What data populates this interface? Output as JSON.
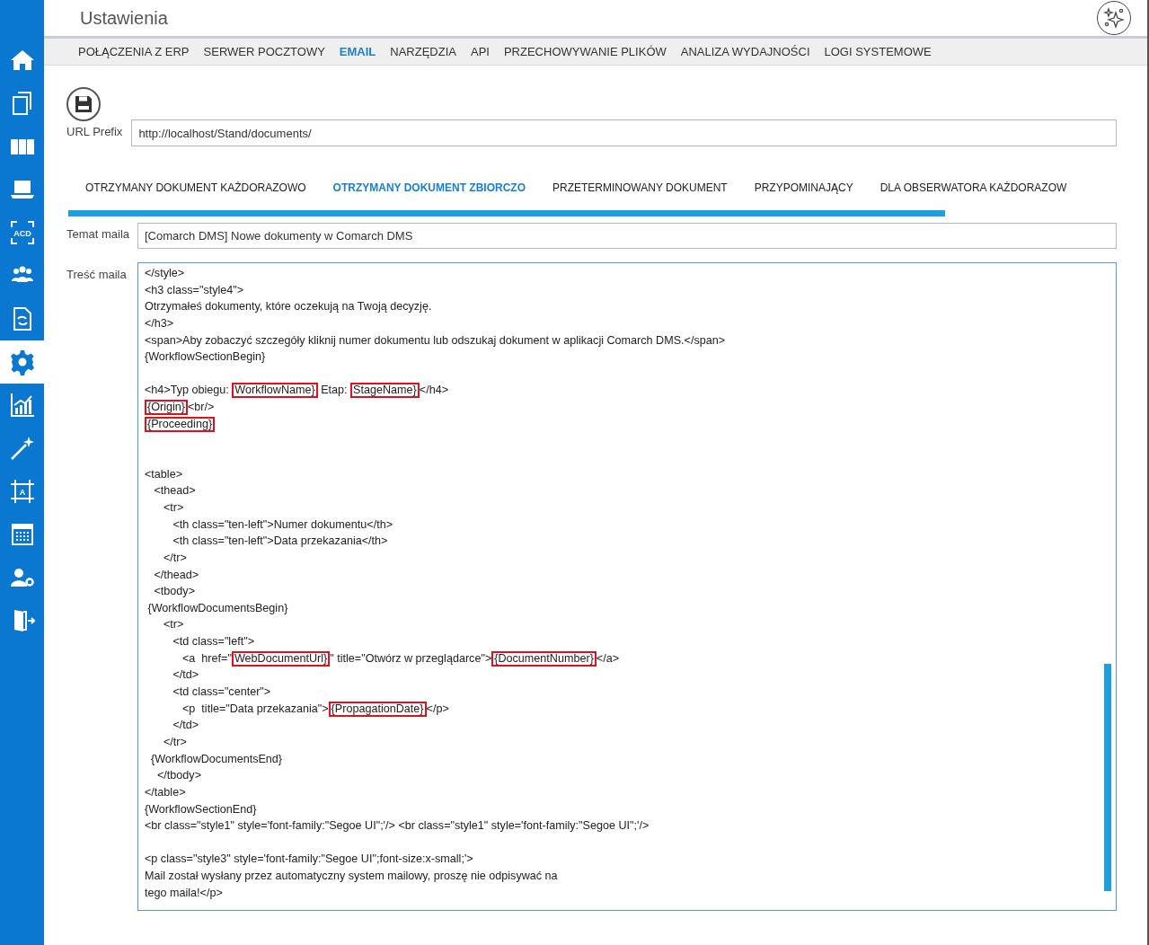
{
  "window": {
    "title": "Ustawienia"
  },
  "sidebar": {
    "items": [
      {
        "kind": "home",
        "selected": false
      },
      {
        "kind": "documents",
        "selected": false
      },
      {
        "kind": "binders",
        "selected": false
      },
      {
        "kind": "laptop",
        "selected": false
      },
      {
        "kind": "scan",
        "label": "ACD",
        "selected": false
      },
      {
        "kind": "people",
        "selected": false
      },
      {
        "kind": "doc-sync",
        "selected": false
      },
      {
        "kind": "gear",
        "selected": true
      },
      {
        "kind": "chart",
        "selected": false
      },
      {
        "kind": "wand",
        "selected": false
      },
      {
        "kind": "crop",
        "label": "A",
        "selected": false
      },
      {
        "kind": "calendar",
        "selected": false
      },
      {
        "kind": "user-gear",
        "selected": false
      },
      {
        "kind": "exit",
        "selected": false
      }
    ]
  },
  "nav": [
    {
      "label": "POŁĄCZENIA Z ERP",
      "selected": false
    },
    {
      "label": "SERWER POCZTOWY",
      "selected": false
    },
    {
      "label": "EMAIL",
      "selected": true
    },
    {
      "label": "NARZĘDZIA",
      "selected": false
    },
    {
      "label": "API",
      "selected": false
    },
    {
      "label": "PRZECHOWYWANIE PLIKÓW",
      "selected": false
    },
    {
      "label": "ANALIZA WYDAJNOŚCI",
      "selected": false
    },
    {
      "label": "LOGI SYSTEMOWE",
      "selected": false
    }
  ],
  "url_prefix": {
    "label": "URL Prefix",
    "value": "http://localhost/Stand/documents/"
  },
  "email_tabs": [
    {
      "label": "OTRZYMANY DOKUMENT KAŻDORAZOWO",
      "selected": false
    },
    {
      "label": "OTRZYMANY DOKUMENT ZBIORCZO",
      "selected": true
    },
    {
      "label": "PRZETERMINOWANY DOKUMENT",
      "selected": false
    },
    {
      "label": "PRZYPOMINAJĄCY",
      "selected": false
    },
    {
      "label": "DLA OBSERWATORA KAŻDORAZOW",
      "selected": false
    }
  ],
  "subject": {
    "label": "Temat maila",
    "value": "[Comarch DMS] Nowe dokumenty w Comarch DMS"
  },
  "body": {
    "label": "Treść maila",
    "lines": [
      {
        "kind": "code",
        "text": "</style>"
      },
      {
        "kind": "code",
        "text": "<h3 class=\"style4\">"
      },
      {
        "kind": "code",
        "text": "Otrzymałeś dokumenty, które oczekują na Twoją decyzję."
      },
      {
        "kind": "code",
        "text": "</h3>"
      },
      {
        "kind": "code",
        "text": "<span>Aby zobaczyć szczegóły kliknij numer dokumentu lub odszukaj dokument w aplikacji Comarch DMS.</span>"
      },
      {
        "kind": "code",
        "text": "{WorkflowSectionBegin}"
      },
      {
        "kind": "blank"
      },
      {
        "kind": "marked",
        "parts": [
          {
            "text": "<h4>Typ obiegu: ",
            "highlighted": false
          },
          {
            "text": "WorkflowName}",
            "highlighted": true
          },
          {
            "text": " Etap: ",
            "highlighted": false
          },
          {
            "text": "StageName}",
            "highlighted": true
          },
          {
            "text": "</h4>",
            "highlighted": false
          }
        ]
      },
      {
        "kind": "marked",
        "parts": [
          {
            "text": "{Origin}",
            "highlighted": true
          },
          {
            "text": "<br/>",
            "highlighted": false
          }
        ]
      },
      {
        "kind": "marked",
        "parts": [
          {
            "text": "{Proceeding}",
            "highlighted": true
          }
        ]
      },
      {
        "kind": "blank"
      },
      {
        "kind": "blank"
      },
      {
        "kind": "code",
        "text": "<table>"
      },
      {
        "kind": "code",
        "text": "   <thead>"
      },
      {
        "kind": "code",
        "text": "      <tr>"
      },
      {
        "kind": "code",
        "text": "         <th class=\"ten-left\">Numer dokumentu</th>"
      },
      {
        "kind": "code",
        "text": "         <th class=\"ten-left\">Data przekazania</th>"
      },
      {
        "kind": "code",
        "text": "      </tr>"
      },
      {
        "kind": "code",
        "text": "   </thead>"
      },
      {
        "kind": "code",
        "text": "   <tbody>"
      },
      {
        "kind": "code",
        "text": " {WorkflowDocumentsBegin}"
      },
      {
        "kind": "code",
        "text": "      <tr>"
      },
      {
        "kind": "code",
        "text": "         <td class=\"left\">"
      },
      {
        "kind": "marked",
        "parts": [
          {
            "text": "            <a  href=\"",
            "highlighted": false
          },
          {
            "text": "WebDocumentUrl}",
            "highlighted": true
          },
          {
            "text": "\" title=\"Otwórz w przeglądarce\">",
            "highlighted": false
          },
          {
            "text": "{DocumentNumber}",
            "highlighted": true
          },
          {
            "text": "</a>",
            "highlighted": false
          }
        ]
      },
      {
        "kind": "code",
        "text": "         </td>"
      },
      {
        "kind": "code",
        "text": "         <td class=\"center\">"
      },
      {
        "kind": "marked",
        "parts": [
          {
            "text": "            <p  title=\"Data przekazania\">",
            "highlighted": false
          },
          {
            "text": "{PropagationDate}",
            "highlighted": true
          },
          {
            "text": "</p>",
            "highlighted": false
          }
        ]
      },
      {
        "kind": "code",
        "text": "         </td>"
      },
      {
        "kind": "code",
        "text": "      </tr>"
      },
      {
        "kind": "code",
        "text": "  {WorkflowDocumentsEnd}"
      },
      {
        "kind": "code",
        "text": "    </tbody>"
      },
      {
        "kind": "code",
        "text": "</table>"
      },
      {
        "kind": "code",
        "text": "{WorkflowSectionEnd}"
      },
      {
        "kind": "code",
        "text": "<br class=\"style1\" style='font-family:\"Segoe UI\";'/> <br class=\"style1\" style='font-family:\"Segoe UI\";'/>"
      },
      {
        "kind": "blank"
      },
      {
        "kind": "code",
        "text": "<p class=\"style3\" style='font-family:\"Segoe UI\";font-size:x-small;'>"
      },
      {
        "kind": "code",
        "text": "Mail został wysłany przez automatyczny system mailowy, proszę nie odpisywać na"
      },
      {
        "kind": "code",
        "text": "tego maila!</p>"
      }
    ]
  }
}
